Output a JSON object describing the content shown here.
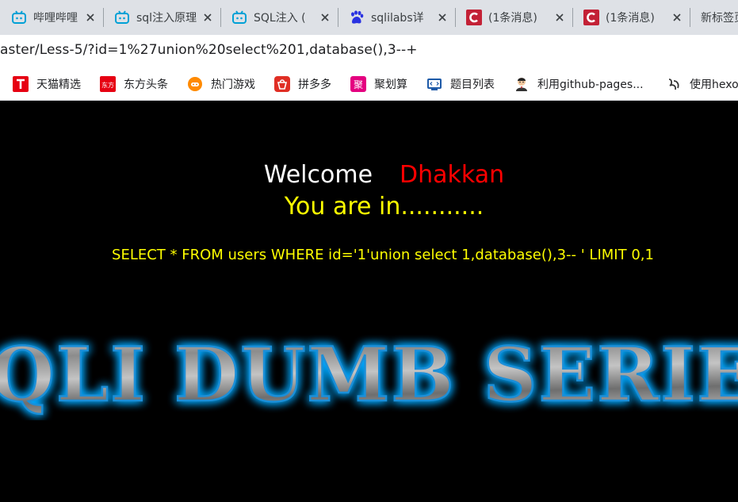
{
  "tabs": [
    {
      "title": "哔哩哔哩 (",
      "icon": "bilibili-icon"
    },
    {
      "title": "sql注入原理",
      "icon": "bilibili-icon"
    },
    {
      "title": "SQL注入 (",
      "icon": "bilibili-icon"
    },
    {
      "title": "sqlilabs详",
      "icon": "baidu-icon"
    },
    {
      "title": "(1条消息)",
      "icon": "csdn-icon"
    },
    {
      "title": "(1条消息)",
      "icon": "csdn-icon"
    },
    {
      "title": "新标签页",
      "icon": "new-tab"
    }
  ],
  "address": {
    "url": "aster/Less-5/?id=1%27union%20select%201,database(),3--+"
  },
  "bookmarks": [
    {
      "label": "天猫精选",
      "icon": "tmall-icon",
      "color": "#e60012"
    },
    {
      "label": "东方头条",
      "icon": "dongfang-icon",
      "color": "#e60012"
    },
    {
      "label": "热门游戏",
      "icon": "game-icon",
      "color": "#ff8a00"
    },
    {
      "label": "拼多多",
      "icon": "pinduoduo-icon",
      "color": "#e02e24"
    },
    {
      "label": "聚划算",
      "icon": "juhuasuan-icon",
      "color": "#e4007f"
    },
    {
      "label": "题目列表",
      "icon": "code-icon",
      "color": "#1e5aa8"
    },
    {
      "label": "利用github-pages...",
      "icon": "avatar-icon",
      "color": "#333333"
    },
    {
      "label": "使用hexo",
      "icon": "hexo-icon",
      "color": "#333333"
    }
  ],
  "page": {
    "welcome": "Welcome",
    "name": "Dhakkan",
    "status": "You are in...........",
    "query": "SELECT * FROM users WHERE id='1'union select 1,database(),3-- ' LIMIT 0,1",
    "banner": "SQLI DUMB SERIES"
  },
  "colors": {
    "background": "#000000",
    "welcome": "#ffffff",
    "name": "#ff0000",
    "status": "#ffff00",
    "banner_glow": "#00a8ff"
  }
}
